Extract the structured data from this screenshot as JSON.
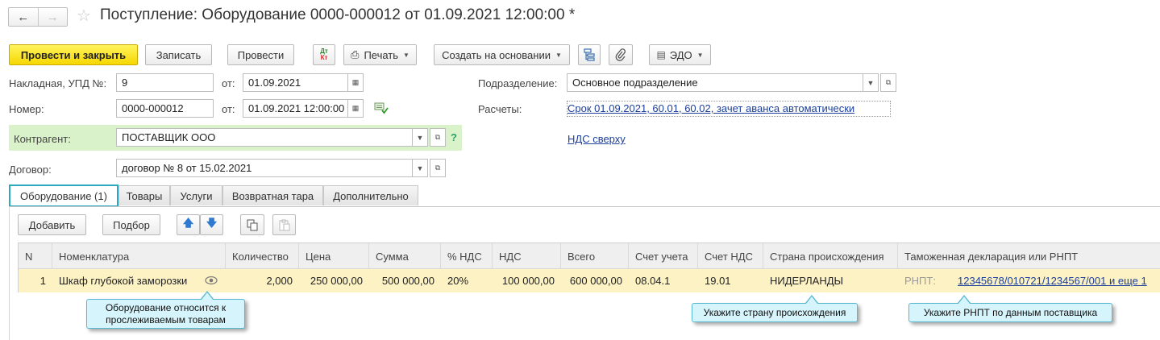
{
  "header": {
    "title": "Поступление: Оборудование 0000-000012 от 01.09.2021 12:00:00 *"
  },
  "toolbar": {
    "post_close": "Провести и закрыть",
    "save": "Записать",
    "post": "Провести",
    "dt_kt_top": "Дт",
    "dt_kt_bottom": "Кт",
    "print": "Печать",
    "create_based": "Создать на основании",
    "edo": "ЭДО"
  },
  "form": {
    "invoice_label": "Накладная, УПД №:",
    "invoice_value": "9",
    "from_label": "от:",
    "invoice_date": "01.09.2021",
    "number_label": "Номер:",
    "number_value": "0000-000012",
    "number_from_label": "от:",
    "number_date": "01.09.2021 12:00:00",
    "counterparty_label": "Контрагент:",
    "counterparty_value": "ПОСТАВЩИК ООО",
    "help": "?",
    "contract_label": "Договор:",
    "contract_value": "договор № 8 от 15.02.2021",
    "division_label": "Подразделение:",
    "division_value": "Основное подразделение",
    "settlements_label": "Расчеты:",
    "settlements_link": "Срок 01.09.2021, 60.01, 60.02, зачет аванса автоматически",
    "vat_link": "НДС сверху"
  },
  "tabs": [
    {
      "label": "Оборудование (1)",
      "active": true
    },
    {
      "label": "Товары",
      "active": false
    },
    {
      "label": "Услуги",
      "active": false
    },
    {
      "label": "Возвратная тара",
      "active": false
    },
    {
      "label": "Дополнительно",
      "active": false
    }
  ],
  "table_toolbar": {
    "add": "Добавить",
    "pick": "Подбор"
  },
  "table": {
    "columns": [
      "N",
      "Номенклатура",
      "Количество",
      "Цена",
      "Сумма",
      "% НДС",
      "НДС",
      "Всего",
      "Счет учета",
      "Счет НДС",
      "Страна происхождения",
      "Таможенная декларация или РНПТ"
    ],
    "row": {
      "n": "1",
      "item": "Шкаф глубокой заморозки",
      "qty": "2,000",
      "price": "250 000,00",
      "sum": "500 000,00",
      "vat_rate": "20%",
      "vat": "100 000,00",
      "total": "600 000,00",
      "account": "08.04.1",
      "vat_account": "19.01",
      "country": "НИДЕРЛАНДЫ",
      "rnpt_label": "РНПТ:",
      "rnpt_link": "12345678/010721/1234567/001 и еще 1"
    }
  },
  "callouts": {
    "traceable_line1": "Оборудование относится к",
    "traceable_line2": "прослеживаемым товарам",
    "country": "Укажите страну происхождения",
    "rnpt": "Укажите РНПТ по данным поставщика"
  },
  "colors": {
    "primary_button": "#f6d700",
    "active_tab_border": "#2aa9c0",
    "counterparty_bg": "#d9f2c9",
    "selected_row": "#fdf2c4",
    "link": "#1c3f9c",
    "callout_bg": "#d6f4fb"
  }
}
